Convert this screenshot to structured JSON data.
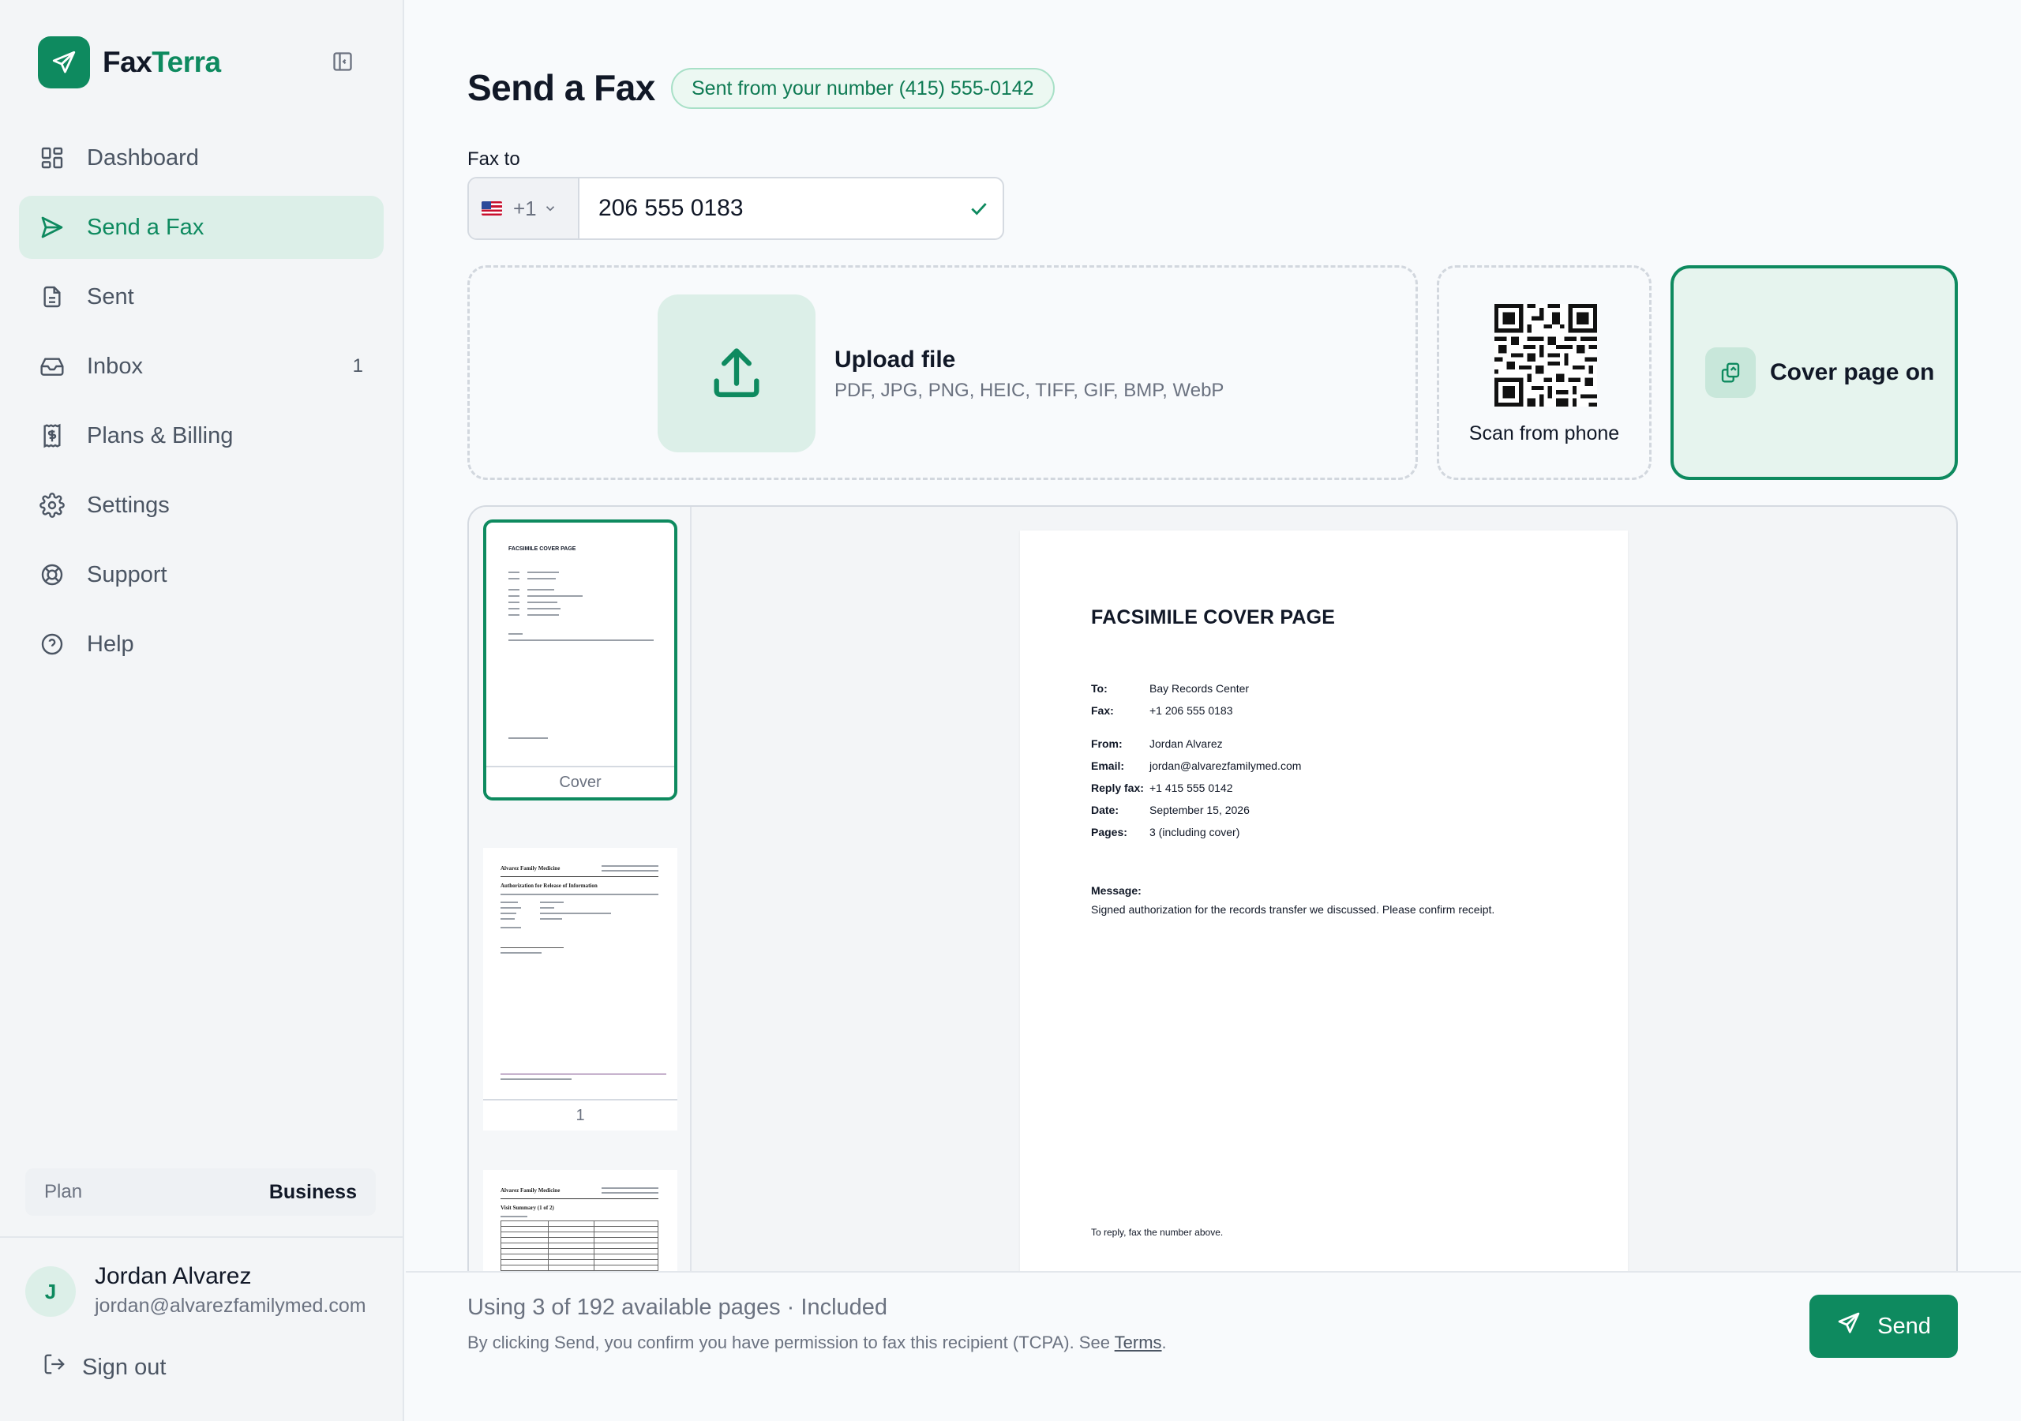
{
  "brand": {
    "name_part1": "Fax",
    "name_part2": "Terra"
  },
  "sidebar": {
    "items": [
      {
        "label": "Dashboard",
        "icon": "dashboard-icon"
      },
      {
        "label": "Send a Fax",
        "icon": "send-icon",
        "active": true
      },
      {
        "label": "Sent",
        "icon": "document-icon"
      },
      {
        "label": "Inbox",
        "icon": "inbox-icon",
        "count": "1"
      },
      {
        "label": "Plans & Billing",
        "icon": "billing-icon"
      },
      {
        "label": "Settings",
        "icon": "gear-icon"
      },
      {
        "label": "Support",
        "icon": "lifebuoy-icon"
      },
      {
        "label": "Help",
        "icon": "help-circle-icon"
      }
    ],
    "plan": {
      "label": "Plan",
      "value": "Business"
    },
    "user": {
      "initial": "J",
      "name": "Jordan Alvarez",
      "email": "jordan@alvarezfamilymed.com"
    },
    "sign_out": "Sign out"
  },
  "header": {
    "title": "Send a Fax",
    "sender_badge": "Sent from your number (415) 555-0142"
  },
  "fax_to": {
    "label": "Fax to",
    "country_code": "+1",
    "number": "206 555 0183"
  },
  "upload": {
    "title": "Upload file",
    "formats": "PDF, JPG, PNG, HEIC, TIFF, GIF, BMP, WebP"
  },
  "scan": {
    "label": "Scan from phone"
  },
  "cover_toggle": {
    "label": "Cover page on"
  },
  "thumbnails": [
    {
      "caption": "Cover",
      "selected": true
    },
    {
      "caption": "1"
    },
    {
      "caption": ""
    }
  ],
  "thumb_text": {
    "cover_title": "FACSIMILE COVER PAGE",
    "clinic": "Alvarez Family Medicine",
    "auth_title": "Authorization for Release of Information",
    "visit_title": "Visit Summary (1 of 2)"
  },
  "cover_page": {
    "title": "FACSIMILE COVER PAGE",
    "fields": [
      {
        "k": "To:",
        "v": "Bay Records Center"
      },
      {
        "k": "Fax:",
        "v": "+1 206 555 0183"
      },
      {
        "k": "From:",
        "v": "Jordan Alvarez"
      },
      {
        "k": "Email:",
        "v": "jordan@alvarezfamilymed.com"
      },
      {
        "k": "Reply fax:",
        "v": "+1 415 555 0142"
      },
      {
        "k": "Date:",
        "v": "September 15, 2026"
      },
      {
        "k": "Pages:",
        "v": "3 (including cover)"
      }
    ],
    "message_label": "Message:",
    "message": "Signed authorization for the records transfer we discussed. Please confirm receipt.",
    "footer": "To reply, fax the number above."
  },
  "footer": {
    "usage": "Using 3 of 192 available pages · Included",
    "consent": "By clicking Send, you confirm you have permission to fax this recipient (TCPA). See",
    "terms_link": "Terms",
    "send_label": "Send"
  },
  "colors": {
    "accent": "#0e8a5f",
    "accent_soft": "#dcefe8"
  }
}
